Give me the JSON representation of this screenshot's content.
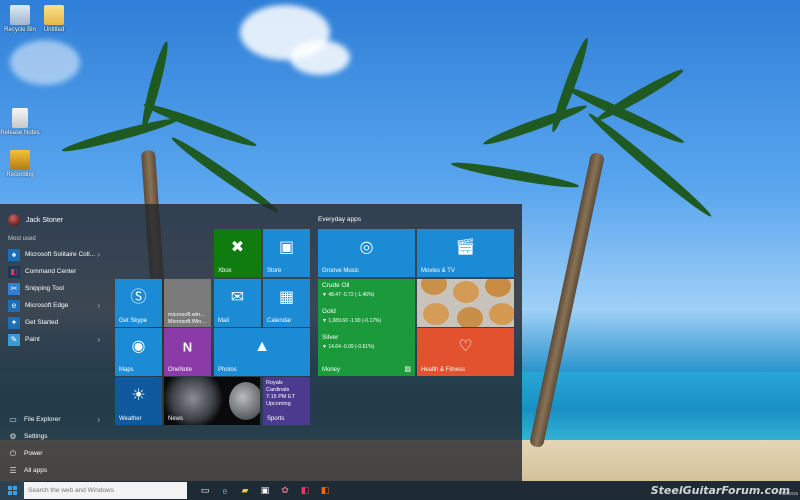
{
  "desktop": {
    "icons": [
      {
        "label": "Recycle Bin"
      },
      {
        "label": "Untitled"
      },
      {
        "label": "Release Notes"
      },
      {
        "label": "Recording"
      }
    ]
  },
  "start_menu": {
    "user_name": "Jack Stoner",
    "most_used_label": "Most used",
    "most_used": [
      {
        "label": "Microsoft Solitaire Coll...",
        "icon": "cards-icon",
        "has_arrow": true
      },
      {
        "label": "Command Center",
        "icon": "command-center-icon",
        "has_arrow": false
      },
      {
        "label": "Snipping Tool",
        "icon": "scissors-icon",
        "has_arrow": false
      },
      {
        "label": "Microsoft Edge",
        "icon": "edge-icon",
        "has_arrow": true
      },
      {
        "label": "Get Started",
        "icon": "lightbulb-icon",
        "has_arrow": false
      },
      {
        "label": "Paint",
        "icon": "paint-icon",
        "has_arrow": true
      }
    ],
    "bottom": [
      {
        "label": "File Explorer",
        "icon": "folder-icon",
        "has_arrow": true
      },
      {
        "label": "Settings",
        "icon": "gear-icon",
        "has_arrow": false
      },
      {
        "label": "Power",
        "icon": "power-icon",
        "has_arrow": false
      },
      {
        "label": "All apps",
        "icon": "list-icon",
        "has_arrow": false
      }
    ],
    "everyday_header": "Everyday apps",
    "tiles": {
      "xbox": "Xbox",
      "store": "Store",
      "skype": "Get Skype",
      "ms_win_1": "microsoft.win...",
      "ms_win_2": "Microsoft.Win...",
      "mail": "Mail",
      "calendar": "Calendar",
      "maps": "Maps",
      "onenote": "OneNote",
      "photos": "Photos",
      "weather": "Weather",
      "news": "News",
      "sports_line1": "Royals",
      "sports_line2": "Cardinals",
      "sports_line3": "7:15 PM ET",
      "sports_line4": "Upcoming",
      "sports": "Sports",
      "groove": "Groove Music",
      "movies": "Movies & TV",
      "money": "Money",
      "health": "Health & Fitness",
      "money_rows": [
        {
          "name": "Crude Oil",
          "detail": "▼ 48.47 -0.72 (-1.46%)"
        },
        {
          "name": "Gold",
          "detail": "▼ 1,089.60 -1.90 (-0.17%)"
        },
        {
          "name": "Silver",
          "detail": "▼ 14.64 -0.09 (-0.61%)"
        }
      ]
    }
  },
  "taskbar": {
    "search_placeholder": "Search the web and Windows",
    "watermark": "SteelGuitarForum.com",
    "date": "7/22/2015"
  },
  "colors": {
    "accent": "#1c8bd6",
    "xbox_green": "#107c10",
    "money_green": "#1a9a3b",
    "health_red": "#e2522e",
    "onenote_purple": "#8a3ba8"
  }
}
